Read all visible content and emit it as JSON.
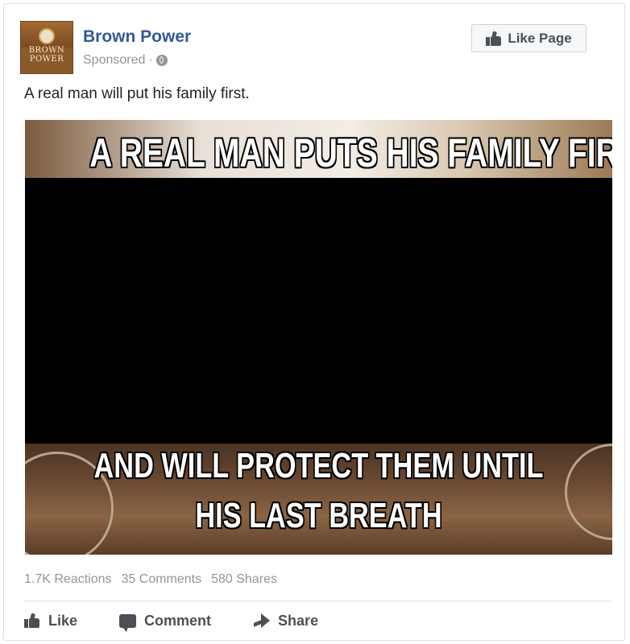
{
  "post": {
    "page_name": "Brown Power",
    "sponsored": "Sponsored",
    "separator": "·",
    "privacy_icon": "globe-icon",
    "like_page_label": "Like Page",
    "text": "A real man will put his family first.",
    "avatar_text_line1": "BROWN",
    "avatar_text_line2": "POWER"
  },
  "image": {
    "caption_top": "A REAL MAN PUTS HIS FAMILY FIRST",
    "caption_bottom_1": "AND WILL PROTECT THEM UNTIL",
    "caption_bottom_2": "HIS LAST BREATH"
  },
  "stats": {
    "reactions": "1.7K Reactions",
    "comments": "35 Comments",
    "shares": "580 Shares"
  },
  "actions": {
    "like": "Like",
    "comment": "Comment",
    "share": "Share"
  },
  "colors": {
    "link": "#365899",
    "meta": "#90949c",
    "text": "#1d2129",
    "action": "#4b4f56"
  }
}
